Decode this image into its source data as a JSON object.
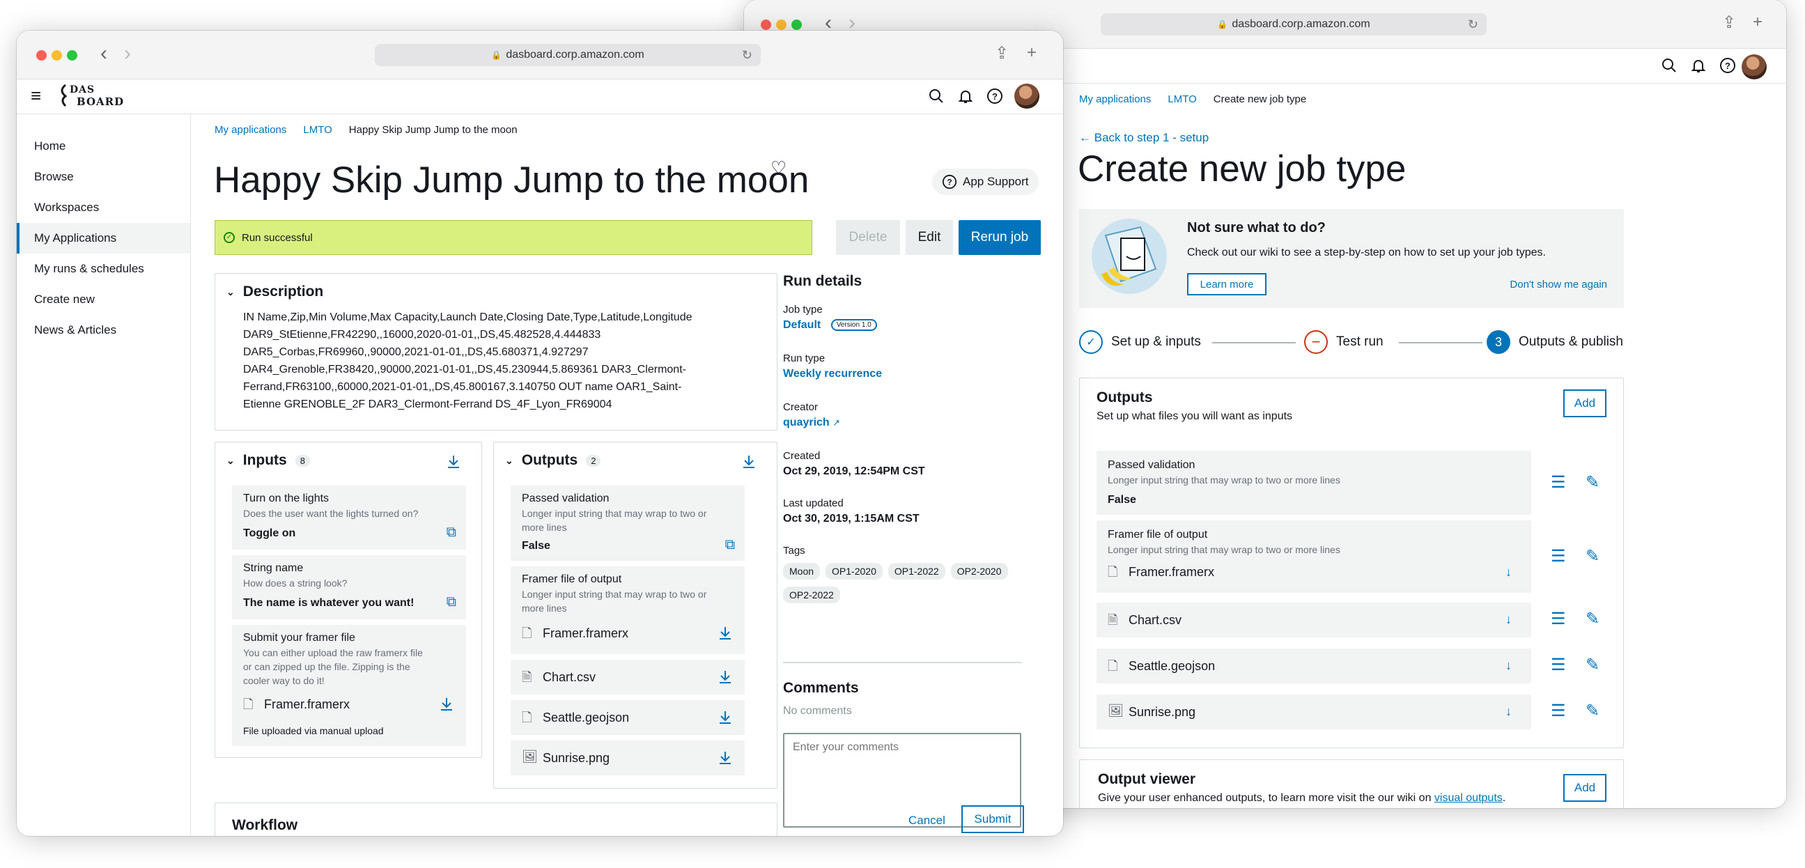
{
  "back_window": {
    "url": "dasboard.corp.amazon.com",
    "breadcrumb": [
      "My applications",
      "LMTO",
      "Create new job type"
    ],
    "back_link": "Back to step 1 - setup",
    "title": "Create new job type",
    "info": {
      "title": "Not sure what to do?",
      "text": "Check out our wiki to see a step-by-step on how to set up your job types.",
      "learn_more": "Learn more",
      "dismiss": "Don't show me again"
    },
    "steps": [
      {
        "label": "Set up & inputs",
        "state": "done"
      },
      {
        "label": "Test run",
        "state": "error"
      },
      {
        "label": "Outputs & publish",
        "state": "current",
        "number": "3"
      }
    ],
    "outputs": {
      "title": "Outputs",
      "subtitle": "Set up what files you will want as inputs",
      "add": "Add",
      "rows": [
        {
          "title": "Passed validation",
          "sub": "Longer input string that may wrap to two or more lines",
          "value": "False"
        },
        {
          "title": "Framer file of output",
          "sub": "Longer input string that may wrap to two or more lines",
          "file": "Framer.framerx"
        },
        {
          "file": "Chart.csv"
        },
        {
          "file": "Seattle.geojson"
        },
        {
          "file": "Sunrise.png"
        }
      ]
    },
    "viewer": {
      "title": "Output viewer",
      "text": "Give your user enhanced outputs, to learn more visit the our wiki on",
      "link": "visual outputs",
      "add": "Add"
    }
  },
  "front_window": {
    "url": "dasboard.corp.amazon.com",
    "logo": [
      "DAS",
      "BOARD"
    ],
    "sidebar": [
      "Home",
      "Browse",
      "Workspaces",
      "My Applications",
      "My runs & schedules",
      "Create new",
      "News & Articles"
    ],
    "breadcrumb": [
      "My applications",
      "LMTO",
      "Happy Skip Jump Jump to the moon"
    ],
    "title": "Happy Skip Jump Jump to the moon",
    "app_support": "App Support",
    "banner": "Run successful",
    "buttons": {
      "delete": "Delete",
      "edit": "Edit",
      "rerun": "Rerun job"
    },
    "description": {
      "title": "Description",
      "lines": [
        "IN Name,Zip,Min Volume,Max Capacity,Launch Date,Closing Date,Type,Latitude,Longitude",
        "DAR9_StEtienne,FR42290,,16000,2020-01-01,,DS,45.482528,4.444833",
        "DAR5_Corbas,FR69960,,90000,2021-01-01,,DS,45.680371,4.927297",
        "DAR4_Grenoble,FR38420,,90000,2021-01-01,,DS,45.230944,5.869361 DAR3_Clermont-",
        "Ferrand,FR63100,,60000,2021-01-01,,DS,45.800167,3.140750 OUT name OAR1_Saint-",
        "Etienne GRENOBLE_2F DAR3_Clermont-Ferrand DS_4F_Lyon_FR69004"
      ]
    },
    "inputs": {
      "title": "Inputs",
      "count": "8",
      "items": [
        {
          "title": "Turn on the lights",
          "sub": "Does the user want the lights turned on?",
          "value": "Toggle on"
        },
        {
          "title": "String name",
          "sub": "How does a string look?",
          "value": "The name is whatever you want!"
        },
        {
          "title": "Submit your framer file",
          "sub": [
            "You can either upload the  raw framerx file",
            "or can zipped up the file. Zipping is the",
            "cooler way to do it!"
          ],
          "file": "Framer.framerx",
          "note": "File uploaded via manual upload"
        }
      ]
    },
    "outputs": {
      "title": "Outputs",
      "count": "2",
      "items": [
        {
          "title": "Passed validation",
          "sub": [
            "Longer input string that may wrap to two or",
            "more lines"
          ],
          "value": "False"
        },
        {
          "title": "Framer file of output",
          "sub": [
            "Longer input string that may wrap to two or",
            "more lines"
          ],
          "file": "Framer.framerx"
        },
        {
          "file": "Chart.csv"
        },
        {
          "file": "Seattle.geojson"
        },
        {
          "file": "Sunrise.png"
        }
      ]
    },
    "run_details": {
      "title": "Run details",
      "job_type_label": "Job type",
      "job_type": "Default",
      "version": "Version 1.0",
      "run_type_label": "Run type",
      "run_type": "Weekly recurrence",
      "creator_label": "Creator",
      "creator": "quayrich",
      "created_label": "Created",
      "created": "Oct 29, 2019, 12:54PM CST",
      "updated_label": "Last updated",
      "updated": "Oct 30, 2019, 1:15AM CST",
      "tags_label": "Tags",
      "tags": [
        "Moon",
        "OP1-2020",
        "OP1-2022",
        "OP2-2020",
        "OP2-2022"
      ]
    },
    "comments": {
      "title": "Comments",
      "empty": "No comments",
      "placeholder": "Enter your comments",
      "cancel": "Cancel",
      "submit": "Submit"
    },
    "workflow": "Workflow"
  }
}
